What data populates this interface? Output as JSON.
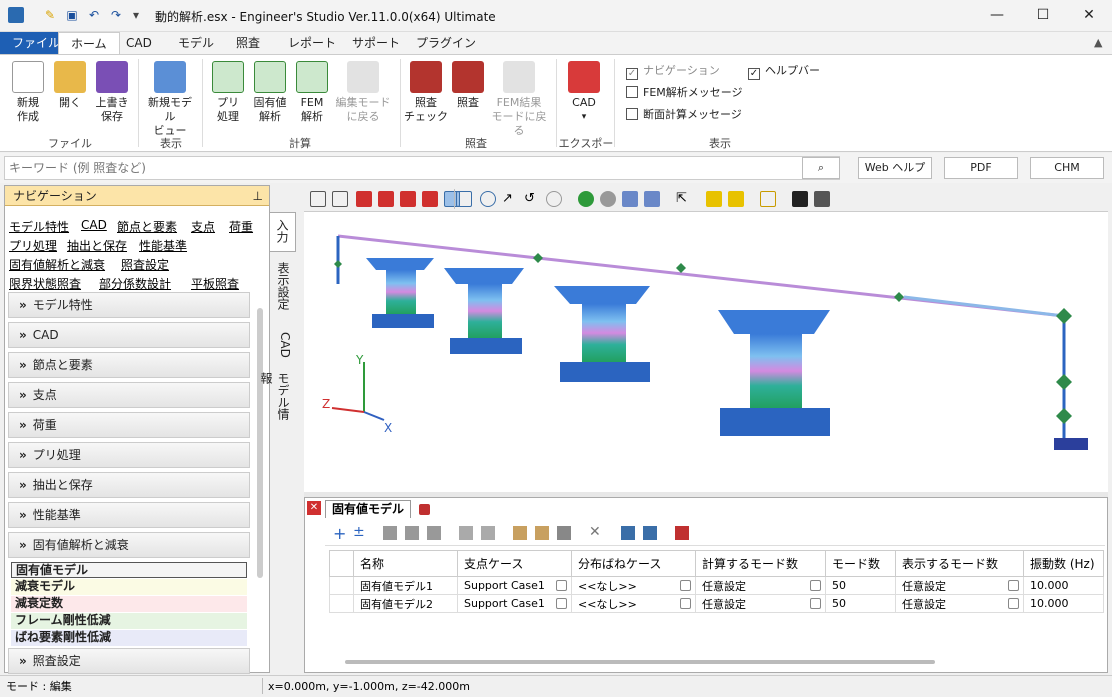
{
  "window": {
    "title": "動的解析.esx - Engineer's Studio Ver.11.0.0(x64) Ultimate"
  },
  "menu": {
    "tabs": [
      "ファイル",
      "ホーム",
      "CAD",
      "モデル",
      "照査",
      "レポート",
      "サポート",
      "プラグイン"
    ]
  },
  "ribbon": {
    "buttons": [
      "新規\n作成",
      "開く",
      "上書き\n保存",
      "新規モデル\nビュー",
      "プリ\n処理",
      "固有値\n解析",
      "FEM\n解析",
      "編集モード\nに戻る",
      "照査\nチェック",
      "照査",
      "FEM結果\nモードに戻る",
      "CAD"
    ],
    "groups": [
      "ファイル",
      "表示",
      "計算",
      "照査",
      "エクスポート",
      "表示"
    ],
    "checks": {
      "navigation": "ナビゲーション",
      "helpbar": "ヘルプバー",
      "fem_msg": "FEM解析メッセージ",
      "section_msg": "断面計算メッセージ"
    }
  },
  "search": {
    "placeholder": "キーワード (例 照査など)",
    "web_help": "Web ヘルプ",
    "pdf": "PDF",
    "chm": "CHM"
  },
  "nav": {
    "title": "ナビゲーション",
    "links": [
      "モデル特性",
      "CAD",
      "節点と要素",
      "支点",
      "荷重",
      "プリ処理",
      "抽出と保存",
      "性能基準",
      "固有値解析と減衰",
      "照査設定",
      "限界状態照査",
      "部分係数設計",
      "平板照査"
    ],
    "sections": [
      "モデル特性",
      "CAD",
      "節点と要素",
      "支点",
      "荷重",
      "プリ処理",
      "抽出と保存",
      "性能基準",
      "固有値解析と減衰",
      "照査設定"
    ],
    "subitems": [
      "固有値モデル",
      "減衰モデル",
      "減衰定数",
      "フレーム剛性低減",
      "ばね要素剛性低減"
    ],
    "vtabs": [
      "入力",
      "表示設定",
      "CAD",
      "モデル情報"
    ]
  },
  "axes": {
    "y": "Y",
    "z": "Z",
    "x": "X"
  },
  "grid": {
    "tab": "固有値モデル",
    "headers": [
      "名称",
      "支点ケース",
      "分布ばねケース",
      "計算するモード数",
      "モード数",
      "表示するモード数",
      "振動数 (Hz)"
    ],
    "rows": [
      [
        "固有値モデル1",
        "Support Case1",
        "<<なし>>",
        "任意設定",
        "50",
        "任意設定",
        "10.000"
      ],
      [
        "固有値モデル2",
        "Support Case1",
        "<<なし>>",
        "任意設定",
        "50",
        "任意設定",
        "10.000"
      ]
    ]
  },
  "status": {
    "mode": "モード : 編集",
    "coords": "x=0.000m, y=-1.000m, z=-42.000m"
  }
}
